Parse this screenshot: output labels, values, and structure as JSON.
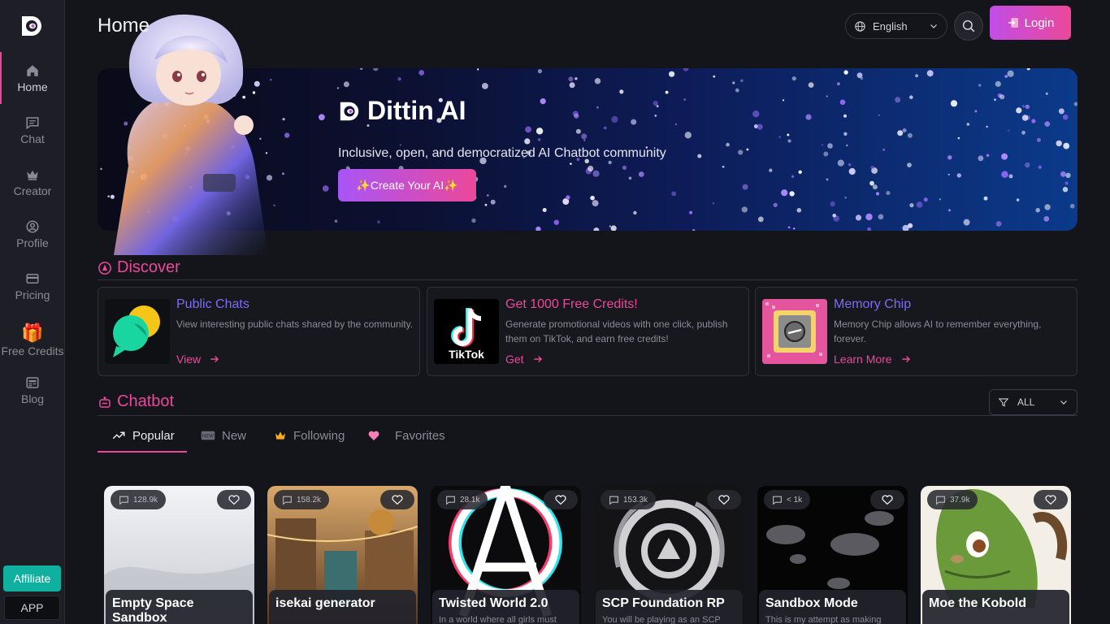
{
  "header": {
    "title": "Home",
    "language": "English",
    "login_label": "Login"
  },
  "sidebar": {
    "items": [
      {
        "label": "Home",
        "icon": "home-icon",
        "active": true
      },
      {
        "label": "Chat",
        "icon": "chat-icon"
      },
      {
        "label": "Creator",
        "icon": "crown-icon"
      },
      {
        "label": "Profile",
        "icon": "profile-icon"
      },
      {
        "label": "Pricing",
        "icon": "card-icon"
      },
      {
        "label": "Free Credits",
        "icon": "gift-icon"
      },
      {
        "label": "Blog",
        "icon": "blog-icon"
      }
    ],
    "affiliate_label": "Affiliate",
    "app_label": "APP"
  },
  "banner": {
    "brand": "Dittin AI",
    "tagline": "Inclusive, open, and democratized AI Chatbot community",
    "cta": "✨Create Your AI✨"
  },
  "discover": {
    "heading": "Discover",
    "cards": [
      {
        "title": "Public Chats",
        "desc": "View interesting public chats shared by the community.",
        "action": "View",
        "title_color": "#7c6cf6"
      },
      {
        "title": "Get 1000 Free Credits!",
        "desc": "Generate promotional videos with one click, publish them on TikTok, and earn free credits!",
        "action": "Get",
        "title_color": "#ec4899",
        "thumb_label": "TikTok"
      },
      {
        "title": "Memory Chip",
        "desc": "Memory Chip allows AI to remember everything, forever.",
        "action": "Learn More",
        "title_color": "#7c6cf6"
      }
    ]
  },
  "chatbot": {
    "heading": "Chatbot",
    "filter": "ALL",
    "tabs": [
      "Popular",
      "New",
      "Following",
      "Favorites"
    ],
    "active_tab": "Popular",
    "bots": [
      {
        "name": "Empty Space Sandbox",
        "count": "128.9k",
        "desc": ""
      },
      {
        "name": "isekai generator",
        "count": "158.2k",
        "desc": ""
      },
      {
        "name": "Twisted World 2.0",
        "count": "28.1k",
        "desc": "In a world where all girls must"
      },
      {
        "name": "SCP Foundation RP",
        "count": "153.3k",
        "desc": "You will be playing as an SCP"
      },
      {
        "name": "Sandbox Mode",
        "count": "< 1k",
        "desc": "This is my attempt as making"
      },
      {
        "name": "Moe the Kobold",
        "count": "37.9k",
        "desc": ""
      }
    ]
  },
  "colors": {
    "accent": "#ec4899",
    "affiliate": "#10b0a0",
    "bg": "#14151a"
  }
}
